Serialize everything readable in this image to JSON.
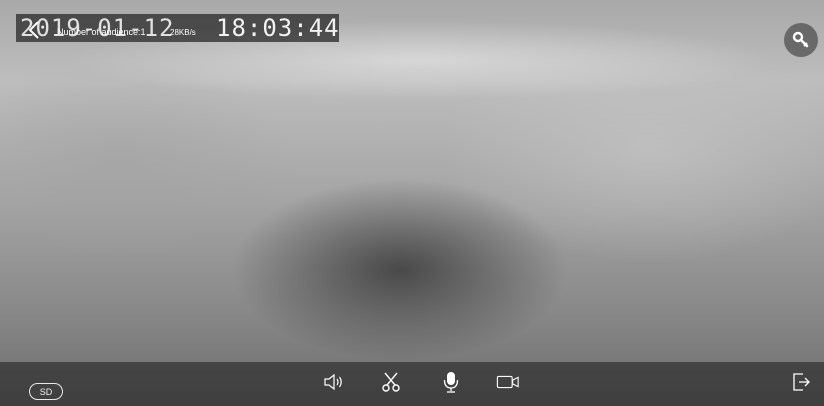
{
  "osd": {
    "date": "2019-01-12",
    "time": "18:03:44",
    "audience": "Number of audience:1",
    "speed": "28KB/s"
  },
  "toolbar": {
    "quality_label": "SD"
  },
  "icons": {
    "back": "chevron-left-icon",
    "settings": "wrench-icon",
    "sound": "speaker-icon",
    "snapshot": "scissors-icon",
    "talk": "microphone-icon",
    "record": "video-camera-icon",
    "exit": "exit-icon"
  }
}
